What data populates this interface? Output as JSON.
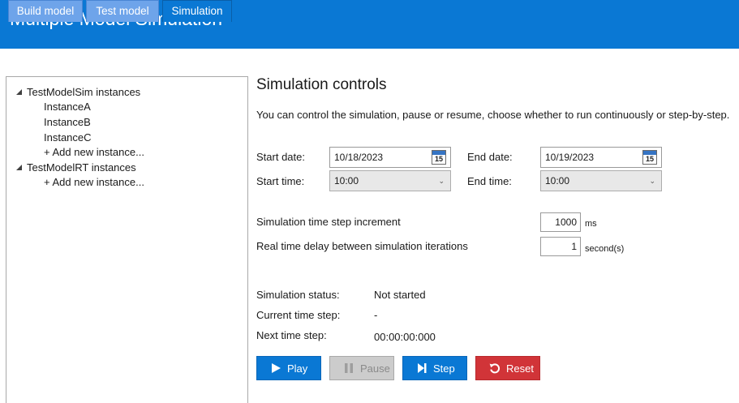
{
  "window": {
    "title": "Multiple Model Simulation"
  },
  "tabs": [
    {
      "label": "Build model",
      "active": false
    },
    {
      "label": "Test model",
      "active": false
    },
    {
      "label": "Simulation",
      "active": true
    }
  ],
  "tree": {
    "groups": [
      {
        "label": "TestModelSim instances",
        "items": [
          "InstanceA",
          "InstanceB",
          "InstanceC"
        ],
        "add_label": "+ Add new instance..."
      },
      {
        "label": "TestModelRT instances",
        "items": [],
        "add_label": "+ Add new instance..."
      }
    ]
  },
  "controls": {
    "heading": "Simulation controls",
    "description": "You can control the simulation, pause or resume, choose whether to run continuously or step-by-step.",
    "start_date_label": "Start date:",
    "start_date": "10/18/2023",
    "end_date_label": "End date:",
    "end_date": "10/19/2023",
    "start_time_label": "Start time:",
    "start_time": "10:00",
    "end_time_label": "End time:",
    "end_time": "10:00",
    "calendar_day": "15",
    "step_increment_label": "Simulation time step increment",
    "step_increment_value": "1000",
    "step_increment_unit": "ms",
    "delay_label": "Real time delay between simulation iterations",
    "delay_value": "1",
    "delay_unit": "second(s)",
    "status_label": "Simulation status:",
    "status_value": "Not started",
    "current_step_label": "Current time step:",
    "current_step_value": "-",
    "next_step_label": "Next time step:",
    "next_step_value": "00:00:00:000"
  },
  "buttons": {
    "play": "Play",
    "pause": "Pause",
    "step": "Step",
    "reset": "Reset"
  },
  "colors": {
    "accent": "#0a78d4",
    "tab_inactive": "#6ea4ea",
    "reset": "#d13438",
    "disabled": "#cccccc"
  }
}
